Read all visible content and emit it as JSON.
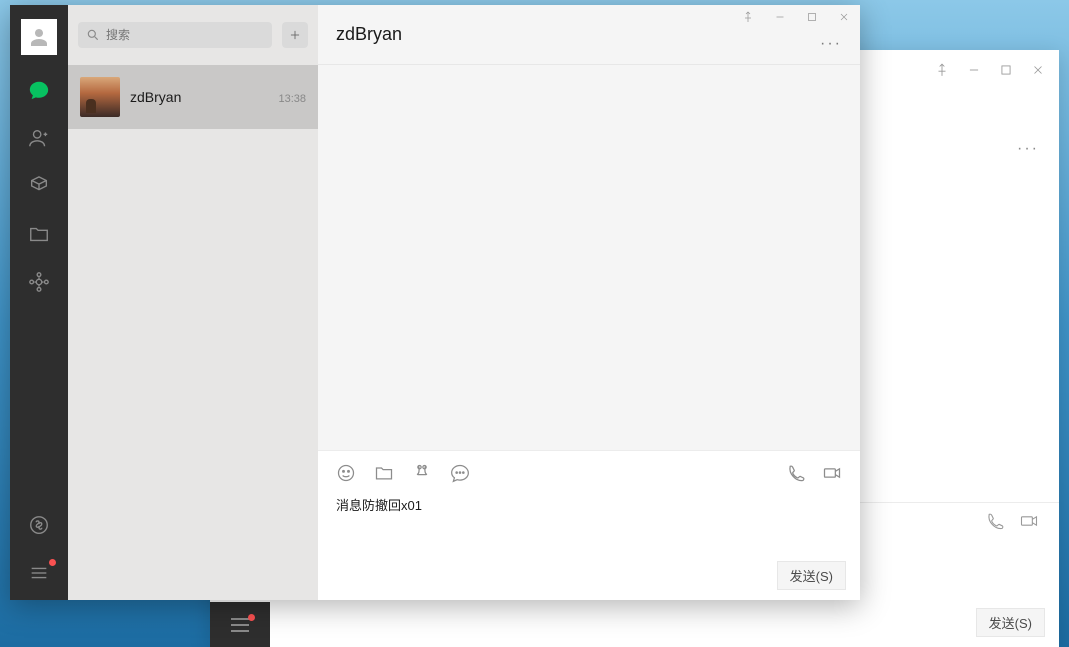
{
  "search": {
    "placeholder": "搜索"
  },
  "conversations": [
    {
      "name": "zdBryan",
      "time": "13:38"
    }
  ],
  "chat": {
    "title": "zdBryan",
    "draft": "消息防撤回x01",
    "send_label": "发送(S)"
  },
  "bgwin": {
    "send_label": "发送(S)"
  }
}
